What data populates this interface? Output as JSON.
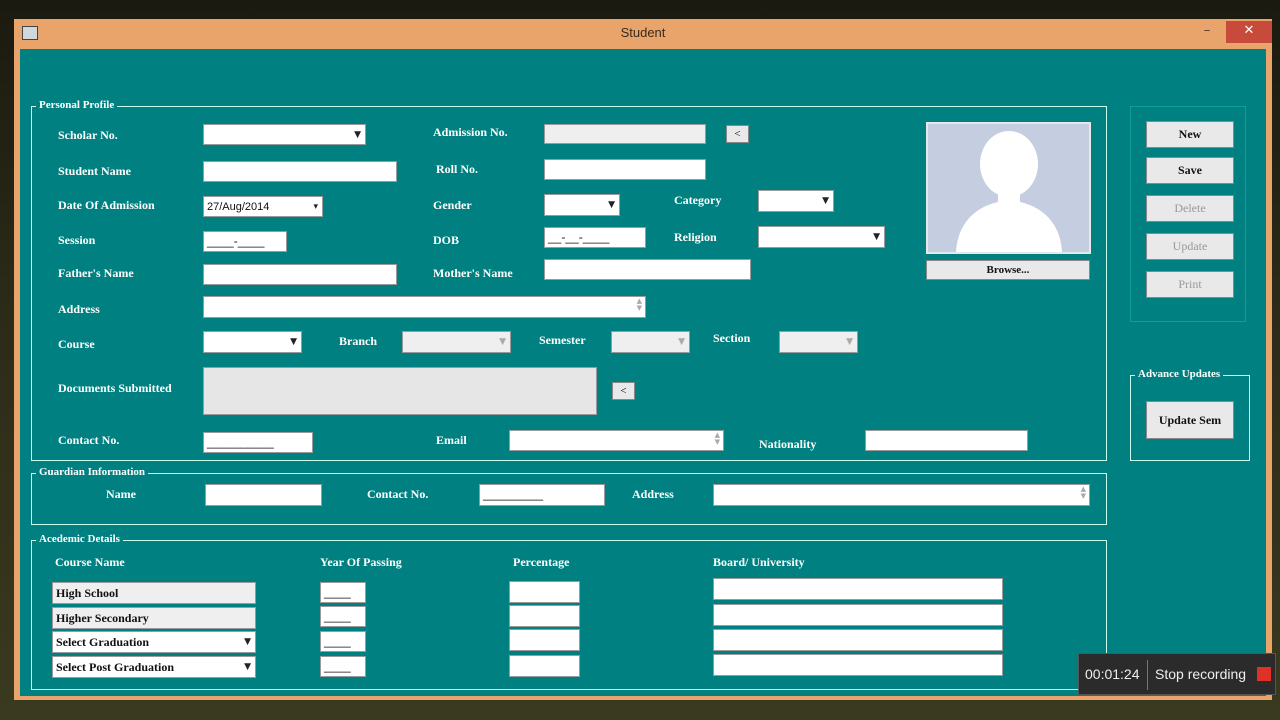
{
  "window": {
    "title": "Student",
    "minimize": "–",
    "maximize": "□",
    "close": "✕"
  },
  "personal": {
    "group_label": "Personal Profile",
    "scholar_no_label": "Scholar No.",
    "admission_no_label": "Admission No.",
    "admission_btn": "<",
    "student_name_label": "Student Name",
    "roll_no_label": "Roll No.",
    "date_of_admission_label": "Date Of Admission",
    "date_of_admission_value": "27/Aug/2014",
    "gender_label": "Gender",
    "category_label": "Category",
    "session_label": "Session",
    "session_mask": "____-____",
    "dob_label": "DOB",
    "dob_mask": "__-__-____",
    "religion_label": "Religion",
    "fathers_name_label": "Father's Name",
    "mothers_name_label": "Mother's Name",
    "address_label": "Address",
    "course_label": "Course",
    "branch_label": "Branch",
    "semester_label": "Semester",
    "section_label": "Section",
    "documents_label": "Documents Submitted",
    "documents_btn": "<",
    "contact_label": "Contact No.",
    "contact_mask": "__________",
    "email_label": "Email",
    "nationality_label": "Nationality",
    "browse_btn": "Browse..."
  },
  "actions": {
    "new": "New",
    "save": "Save",
    "delete": "Delete",
    "update": "Update",
    "print": "Print"
  },
  "advance": {
    "group_label": "Advance Updates",
    "update_sem": "Update Sem"
  },
  "guardian": {
    "group_label": "Guardian Information",
    "name_label": "Name",
    "contact_label": "Contact No.",
    "contact_mask": "_________",
    "address_label": "Address"
  },
  "academic": {
    "group_label": "Acedemic Details",
    "headers": [
      "Course Name",
      "Year Of Passing",
      "Percentage",
      "Board/ University"
    ],
    "rows": [
      {
        "course": "High School",
        "year_mask": "____"
      },
      {
        "course": "Higher Secondary",
        "year_mask": "____"
      },
      {
        "course": "Select Graduation",
        "year_mask": "____"
      },
      {
        "course": "Select Post Graduation",
        "year_mask": "____"
      }
    ]
  },
  "recording": {
    "time": "00:01:24",
    "stop_label": "Stop recording"
  }
}
